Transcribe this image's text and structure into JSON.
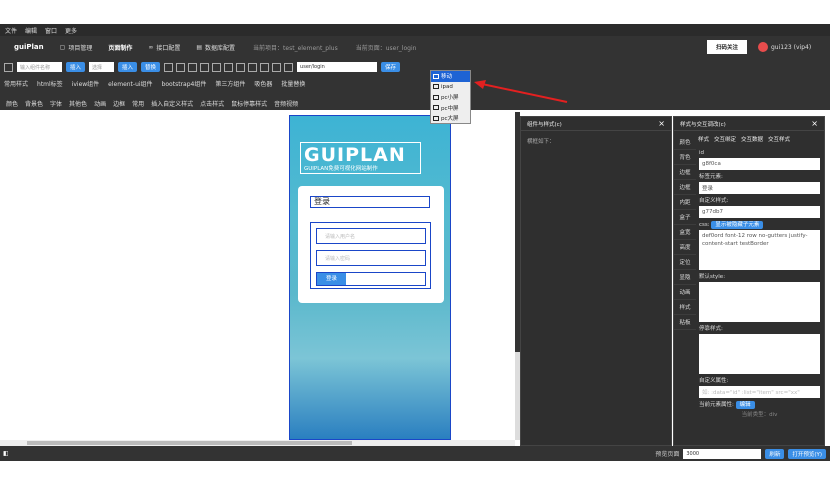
{
  "menu": [
    "文件",
    "编辑",
    "窗口",
    "更多"
  ],
  "nav": {
    "logo": "guiPlan",
    "items": [
      "项目管理",
      "页面制作",
      "接口配置",
      "数据库配置"
    ],
    "active": 1,
    "current_project": "当前项目：test_element_plus",
    "current_page": "当前页面：user_login",
    "follow": "扫码关注",
    "user": "gui123 (vip4)"
  },
  "search": {
    "placeholder": "输入组件名称",
    "insert": "插入",
    "select_placeholder": "选择",
    "insert2": "插入",
    "replace": "替换",
    "path": "user/login",
    "save": "保存"
  },
  "tabs1": [
    "常用样式",
    "html标签",
    "iview组件",
    "element-ui组件",
    "bootstrap4组件",
    "第三方组件",
    "吸色器",
    "批量替换"
  ],
  "tabs2": [
    "颜色",
    "背景色",
    "字体",
    "其他色",
    "动画",
    "边框",
    "常用",
    "插入自定义样式",
    "点击样式",
    "鼠标停靠样式",
    "音频视频"
  ],
  "device_menu": [
    "移动",
    "ipad",
    "pc小屏",
    "pc中屏",
    "pc大屏"
  ],
  "preview": {
    "brand": "GUIPLAN",
    "brand_sub": "GUIPLAN免费可视化网站制作",
    "title": "登录",
    "username_placeholder": "请输入用户名",
    "password_placeholder": "请输入密码",
    "login": "登录"
  },
  "panel_a": {
    "title": "组件与样式(c)",
    "subtitle": "横框如下："
  },
  "panel_b": {
    "title": "样式与交互调改(c)",
    "side_tabs": [
      "颜色",
      "背色",
      "边框",
      "边框",
      "内距",
      "盒子",
      "盒宽",
      "高度",
      "定位",
      "显隐",
      "动画",
      "样式",
      "粘板"
    ],
    "top_tabs": [
      "样式",
      "交互绑定",
      "交互数据",
      "交互样式"
    ],
    "id_label": "id",
    "id_value": "g8f0ca",
    "tag_label": "标签元素:",
    "tag_value": "登录",
    "custom_label": "自定义样式:",
    "custom_value": "g77db7",
    "css_label": "css:",
    "css_btn": "显示被隐藏子元素",
    "css_value": "def0ord font-12 row no-gutters justify-content-start testBorder",
    "default_style": "默认style:",
    "hover_style": "停靠样式:",
    "custom_attr": "自定义属性:",
    "attr_placeholder": "如: :data=\"id\" :list=\"item\" src=\"xx\"",
    "elem_attr": "当前元素属性:",
    "elem_attr_btn": "编辑",
    "elem_type": "当前类型：div"
  },
  "footer": {
    "label": "预览页面",
    "value": "3000",
    "refresh": "刷新",
    "open_preview": "打开预览(Y)"
  }
}
